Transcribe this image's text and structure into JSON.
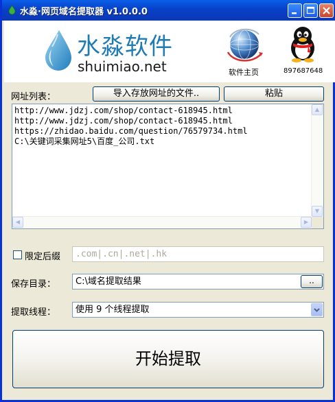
{
  "window": {
    "title": "水淼·网页域名提取器 v1.0.0.0"
  },
  "brand": {
    "logo_cn": "水淼软件",
    "logo_en": "shuimiao.net",
    "home_label": "软件主页",
    "qq_number": "897687648"
  },
  "url_section": {
    "label": "网址列表：",
    "import_button": "导入存放网址的文件..",
    "paste_button": "粘贴",
    "lines": [
      "http://www.jdzj.com/shop/contact-618945.html",
      "http://www.jdzj.com/shop/contact-618945.html",
      "https://zhidao.baidu.com/question/76579734.html",
      "C:\\关键词采集网址5\\百度_公司.txt"
    ]
  },
  "suffix": {
    "checked": false,
    "label": "限定后缀",
    "placeholder": ".com|.cn|.net|.hk"
  },
  "save": {
    "label": "保存目录：",
    "path": "C:\\域名提取结果",
    "browse_button": ".."
  },
  "threads": {
    "label": "提取线程：",
    "selected": "使用 9 个线程提取"
  },
  "actions": {
    "start_button": "开始提取"
  },
  "colors": {
    "titlebar": "#0A3BBE",
    "accent": "#1E7BB3",
    "window_bg": "#ECE9D8"
  }
}
